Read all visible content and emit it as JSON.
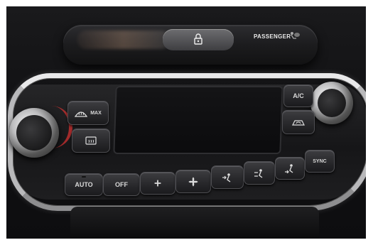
{
  "passenger_label": "PASSENGER",
  "buttons": {
    "defrost_max": "MAX",
    "ac": "A/C",
    "auto": "AUTO",
    "off": "OFF",
    "sync": "SYNC"
  },
  "icons": [
    "lock-icon",
    "airbag-icon",
    "windshield-defrost-max-icon",
    "rear-defrost-icon",
    "recirculation-icon",
    "fan-low-icon",
    "fan-high-icon",
    "vent-face-icon",
    "vent-face-feet-icon",
    "vent-feet-icon"
  ],
  "colors": {
    "heat_indicator": "#dd3333",
    "chrome": "#c0c0c2"
  }
}
